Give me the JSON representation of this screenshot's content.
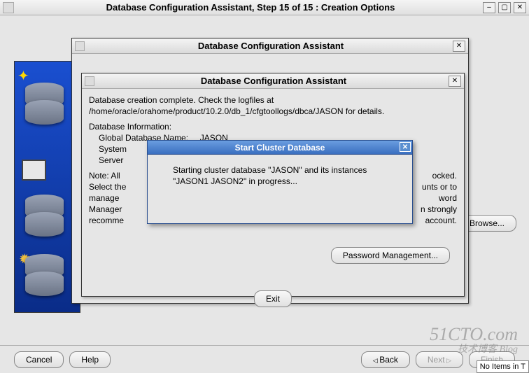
{
  "main_window": {
    "title": "Database Configuration Assistant, Step 15 of 15 : Creation Options"
  },
  "bottom_buttons": {
    "cancel": "Cancel",
    "help": "Help",
    "back": "Back",
    "next": "Next",
    "finish": "Finish",
    "browse": "Browse..."
  },
  "dlg1": {
    "title": "Database Configuration Assistant"
  },
  "dlg2": {
    "title": "Database Configuration Assistant",
    "line1": "Database creation complete. Check the logfiles at /home/oracle/orahome/product/10.2.0/db_1/cfgtoollogs/dbca/JASON for details.",
    "info_heading": "Database Information:",
    "info_global_label": "Global Database Name:",
    "info_global_value": "JASON",
    "info_system_label": "System",
    "info_server_label": "Server",
    "note_l1": "Note: All",
    "note_l1_end": "ocked.",
    "note_l2": "Select the",
    "note_l2_end": "unts or to",
    "note_l3": "manage",
    "note_l3_end": "word",
    "note_l4": "Manager",
    "note_l4_end": "n strongly",
    "note_l5": "recomme",
    "note_l5_end": "account.",
    "password_mgmt": "Password Management...",
    "exit": "Exit"
  },
  "dlg3": {
    "title": "Start Cluster Database",
    "body": "Starting cluster database \"JASON\" and its instances  \"JASON1 JASON2\" in progress..."
  },
  "statusbar": {
    "no_items": "No Items in T"
  },
  "watermark": {
    "main": "51CTO.com",
    "sub": "技术博客    Blog"
  }
}
